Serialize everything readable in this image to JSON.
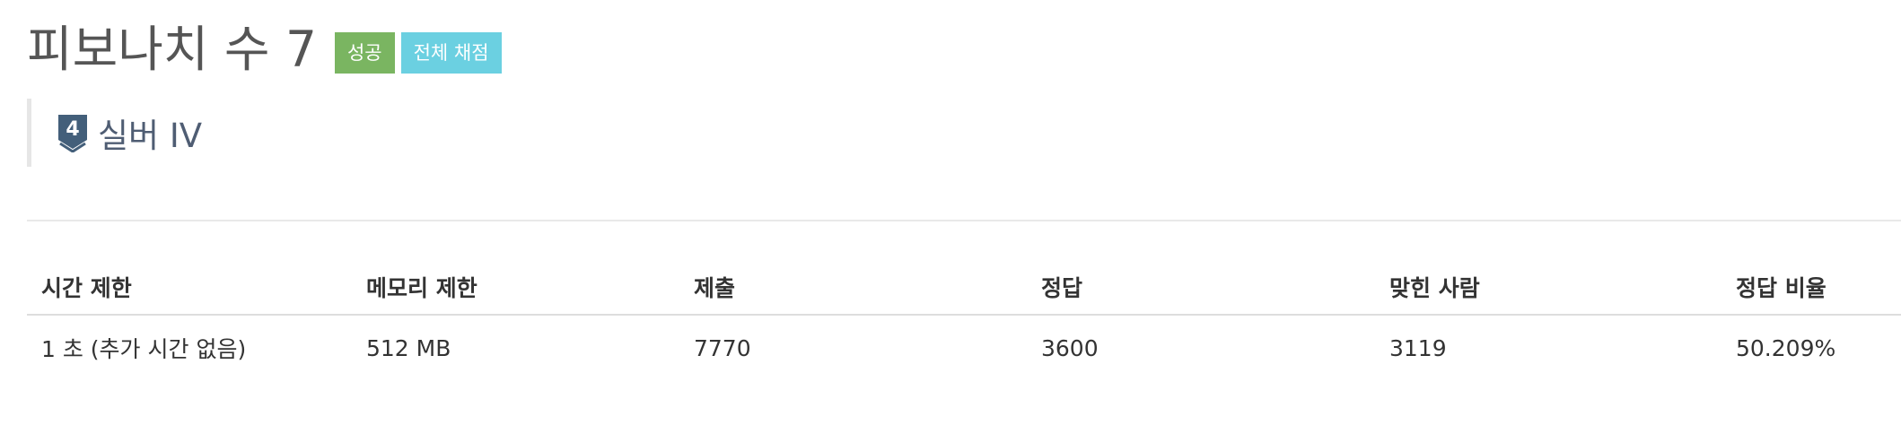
{
  "problem": {
    "title": "피보나치 수 7",
    "badges": {
      "success": "성공",
      "all_judged": "전체 채점"
    },
    "tier": {
      "level": "4",
      "name": "실버 IV",
      "icon": "silver-tier-shield-icon",
      "color": "#435f7a"
    }
  },
  "info_table": {
    "headers": {
      "time_limit": "시간 제한",
      "memory_limit": "메모리 제한",
      "submissions": "제출",
      "accepted": "정답",
      "solved_users": "맞힌 사람",
      "accept_ratio": "정답 비율"
    },
    "values": {
      "time_limit": "1 초 (추가 시간 없음)",
      "memory_limit": "512 MB",
      "submissions": "7770",
      "accepted": "3600",
      "solved_users": "3119",
      "accept_ratio": "50.209%"
    }
  },
  "colors": {
    "success_badge": "#7ab561",
    "info_badge": "#6bd0e1",
    "title_text": "#555555"
  }
}
